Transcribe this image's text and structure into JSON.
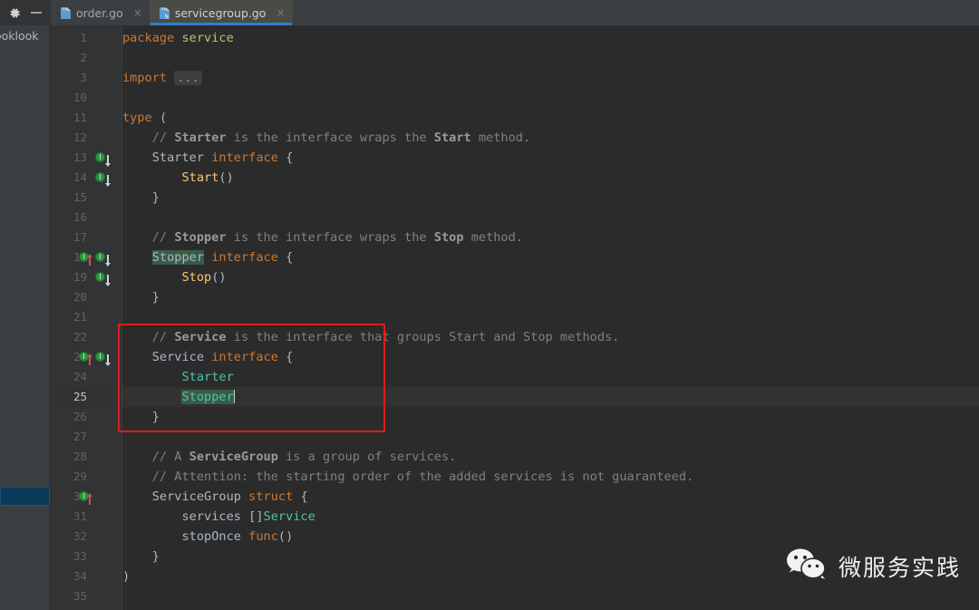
{
  "window": {
    "gear_icon": "gear-icon",
    "minimize_icon": "minimize-icon"
  },
  "sidebar": {
    "project_label": "ooklook",
    "selected_item_label": ""
  },
  "tabs": [
    {
      "label": "order.go",
      "icon": "go-file-icon",
      "close": "×",
      "active": false
    },
    {
      "label": "servicegroup.go",
      "icon": "go-file-icon",
      "close": "×",
      "active": true
    }
  ],
  "editor": {
    "language": "go",
    "current_line": 25,
    "lines": [
      {
        "no": "1",
        "html": "<span class=\"kw\">package</span> <span class=\"plain\" style=\"color:#b6c46e\">service</span>"
      },
      {
        "no": "2",
        "html": ""
      },
      {
        "no": "3",
        "html": "<span class=\"kw\">import</span> <span class=\"fold\">...</span>"
      },
      {
        "no": "10",
        "html": ""
      },
      {
        "no": "11",
        "html": "<span class=\"kw\">type</span> <span class=\"plain\">(</span>"
      },
      {
        "no": "12",
        "html": "    <span class=\"cmt\">// </span><span class=\"cmtb\">Starter</span><span class=\"cmt\"> is the interface wraps the </span><span class=\"cmtb\">Start</span><span class=\"cmt\"> method.</span>"
      },
      {
        "no": "13",
        "html": "    <span class=\"plain\">Starter </span><span class=\"kw\">interface</span><span class=\"plain\"> {</span>"
      },
      {
        "no": "14",
        "html": "        <span class=\"fn\">Start</span><span class=\"plain\">()</span>"
      },
      {
        "no": "15",
        "html": "    <span class=\"plain\">}</span>"
      },
      {
        "no": "16",
        "html": ""
      },
      {
        "no": "17",
        "html": "    <span class=\"cmt\">// </span><span class=\"cmtb\">Stopper</span><span class=\"cmt\"> is the interface wraps the </span><span class=\"cmtb\">Stop</span><span class=\"cmt\"> method.</span>"
      },
      {
        "no": "18",
        "html": "    <span class=\"plain hl\">Stopper</span><span class=\"plain\"> </span><span class=\"kw\">interface</span><span class=\"plain\"> {</span>"
      },
      {
        "no": "19",
        "html": "        <span class=\"fn\">Stop</span><span class=\"plain\">()</span>"
      },
      {
        "no": "20",
        "html": "    <span class=\"plain\">}</span>"
      },
      {
        "no": "21",
        "html": ""
      },
      {
        "no": "22",
        "html": "    <span class=\"cmt\">// </span><span class=\"cmtb\">Service</span><span class=\"cmt\"> is the interface that groups Start and Stop methods.</span>"
      },
      {
        "no": "23",
        "html": "    <span class=\"plain\">Service </span><span class=\"kw\">interface</span><span class=\"plain\"> {</span>"
      },
      {
        "no": "24",
        "html": "        <span class=\"typ\">Starter</span>"
      },
      {
        "no": "25",
        "html": "        <span class=\"typ hl\">Stopper</span><span class=\"caret\"></span>"
      },
      {
        "no": "26",
        "html": "    <span class=\"plain\">}</span>"
      },
      {
        "no": "27",
        "html": ""
      },
      {
        "no": "28",
        "html": "    <span class=\"cmt\">// A </span><span class=\"cmtb\">ServiceGroup</span><span class=\"cmt\"> is a group of services.</span>"
      },
      {
        "no": "29",
        "html": "    <span class=\"cmt\">// Attention: the starting order of the added services is not guaranteed.</span>"
      },
      {
        "no": "30",
        "html": "    <span class=\"plain\">ServiceGroup </span><span class=\"kw\">struct</span><span class=\"plain\"> {</span>"
      },
      {
        "no": "31",
        "html": "        <span class=\"plain\">services []</span><span class=\"typ\">Service</span>"
      },
      {
        "no": "32",
        "html": "        <span class=\"plain\">stopOnce </span><span class=\"kw\">func</span><span class=\"plain\">()</span>"
      },
      {
        "no": "33",
        "html": "    <span class=\"plain\">}</span>"
      },
      {
        "no": "34",
        "html": "<span class=\"plain\">)</span>"
      },
      {
        "no": "35",
        "html": ""
      }
    ],
    "gutter_markers": [
      {
        "line": "13",
        "type": "implemented-by-icon",
        "glyph": "I",
        "arrow": "down"
      },
      {
        "line": "14",
        "type": "implemented-by-icon",
        "glyph": "I",
        "arrow": "down"
      },
      {
        "line": "18",
        "type": "implements-icon",
        "glyph": "I",
        "arrow": "up"
      },
      {
        "line": "18",
        "type": "implemented-by-icon",
        "glyph": "I",
        "arrow": "down"
      },
      {
        "line": "19",
        "type": "implemented-by-icon",
        "glyph": "I",
        "arrow": "down"
      },
      {
        "line": "23",
        "type": "implements-icon",
        "glyph": "I",
        "arrow": "up"
      },
      {
        "line": "23",
        "type": "implemented-by-icon",
        "glyph": "I",
        "arrow": "down"
      },
      {
        "line": "30",
        "type": "implements-icon",
        "glyph": "I",
        "arrow": "up"
      }
    ]
  },
  "annotation": {
    "box_color": "#e01b1b",
    "highlights_lines": "22-26"
  },
  "watermark": {
    "text": "微服务实践",
    "logo": "wechat-logo"
  },
  "colors": {
    "background": "#2b2b2b",
    "gutter": "#313335",
    "chrome": "#3c3f41",
    "accent": "#2d7fd0",
    "keyword": "#cc7832",
    "type": "#4fc1a6",
    "function": "#ffc66d",
    "comment": "#808080",
    "annotation_red": "#e01b1b"
  }
}
